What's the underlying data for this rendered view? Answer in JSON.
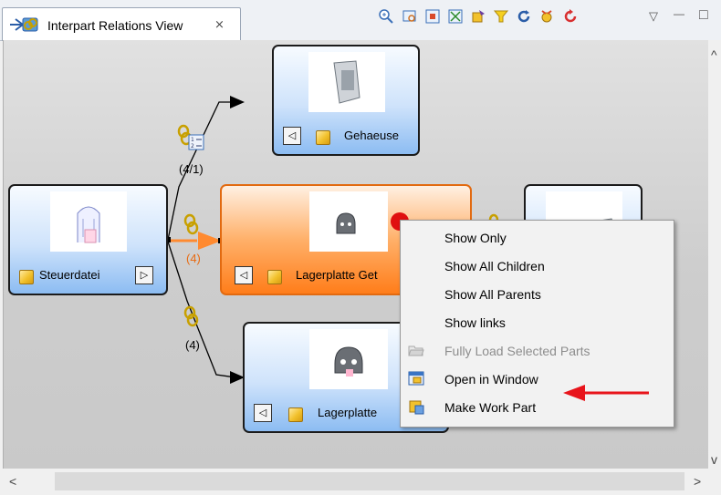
{
  "tab": {
    "title": "Interpart Relations View",
    "close_glyph": "⨯"
  },
  "toolbar": {
    "icons": [
      "zoom-icon",
      "fit-view-icon",
      "layout-icon",
      "expand-icon",
      "load-icon",
      "filter-icon",
      "refresh-icon",
      "settings-icon",
      "reset-icon"
    ],
    "menu_glyph": "▽",
    "minimize_glyph": "—",
    "maximize_glyph": "□"
  },
  "nodes": {
    "steuerdatei": {
      "label": "Steuerdatei",
      "nav": "▷"
    },
    "gehaeuse": {
      "label": "Gehaeuse",
      "nav": "◁"
    },
    "lagerplatte_get": {
      "label": "Lagerplatte Get",
      "nav": "◁"
    },
    "lagerplatte": {
      "label": "Lagerplatte",
      "nav": "◁"
    }
  },
  "edges": {
    "top_label": "(4/1)",
    "middle_label": "(4)",
    "bottom_label": "(4)"
  },
  "context_menu": {
    "items": [
      {
        "label": "Show Only",
        "enabled": true
      },
      {
        "label": "Show All Children",
        "enabled": true
      },
      {
        "label": "Show All Parents",
        "enabled": true
      },
      {
        "label": "Show links",
        "enabled": true
      },
      {
        "label": "Fully Load Selected Parts",
        "enabled": false
      },
      {
        "label": "Open in Window",
        "enabled": true
      },
      {
        "label": "Make Work Part",
        "enabled": true
      }
    ]
  },
  "scrollbar": {
    "left_glyph": "<",
    "right_glyph": ">",
    "up_glyph": "^",
    "down_glyph": "v"
  },
  "colors": {
    "selected_node": "#ff7d1a",
    "node": "#8cbcf2",
    "annotation_arrow": "#e8141b",
    "selection_dot": "#e01010"
  }
}
